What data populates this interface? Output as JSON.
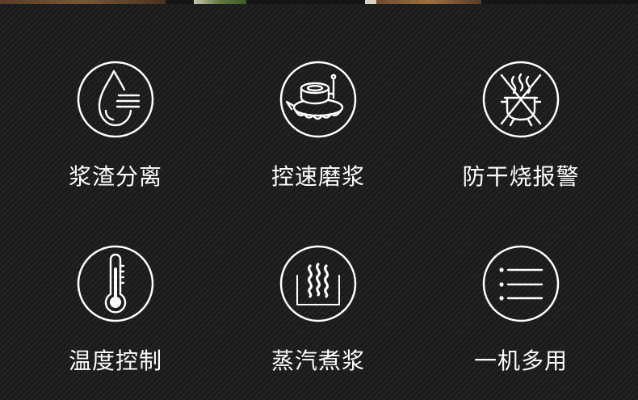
{
  "features": [
    {
      "label": "浆渣分离",
      "icon": "water-drop-icon"
    },
    {
      "label": "控速磨浆",
      "icon": "grinder-icon"
    },
    {
      "label": "防干烧报警",
      "icon": "no-dry-burn-icon"
    },
    {
      "label": "温度控制",
      "icon": "thermometer-icon"
    },
    {
      "label": "蒸汽煮浆",
      "icon": "steam-icon"
    },
    {
      "label": "一机多用",
      "icon": "multi-function-list-icon"
    }
  ],
  "colors": {
    "background": "#1c1c1c",
    "foreground": "#ffffff"
  }
}
